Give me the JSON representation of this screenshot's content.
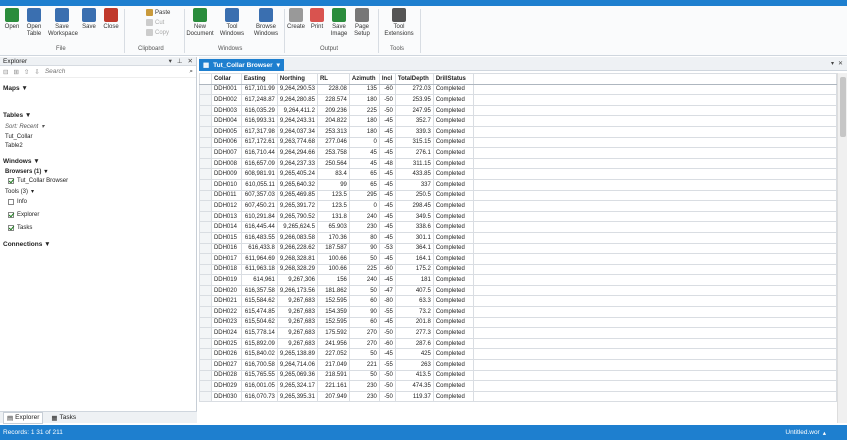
{
  "ribbon": {
    "buttons": [
      {
        "label": "Open",
        "icon": "open-icon",
        "color": "#2a8c3c"
      },
      {
        "label": "Open Table",
        "icon": "open-table-icon",
        "color": "#3a6fb0"
      },
      {
        "label": "Save Workspace",
        "icon": "save-workspace-icon",
        "color": "#3a6fb0"
      },
      {
        "label": "Save",
        "icon": "save-icon",
        "color": "#3a6fb0"
      },
      {
        "label": "Close",
        "icon": "close-icon",
        "color": "#c0392b"
      }
    ],
    "clipboard": {
      "paste": "Paste",
      "cut": "Cut",
      "copy": "Copy"
    },
    "windows": [
      {
        "label": "New Document",
        "icon": "new-document-icon",
        "color": "#2a8c3c"
      },
      {
        "label": "Tool Windows",
        "icon": "tool-windows-icon",
        "color": "#3a6fb0"
      },
      {
        "label": "Browse Windows",
        "icon": "browse-windows-icon",
        "color": "#3a6fb0"
      }
    ],
    "output": [
      {
        "label": "Create",
        "icon": "create-icon",
        "color": "#888"
      },
      {
        "label": "Print",
        "icon": "print-pdf-icon",
        "color": "#d9534f"
      },
      {
        "label": "Save Image",
        "icon": "save-image-icon",
        "color": "#2a8c3c"
      },
      {
        "label": "Page Setup",
        "icon": "page-setup-icon",
        "color": "#666"
      }
    ],
    "tools": [
      {
        "label": "Tool Extensions",
        "icon": "tool-extensions-icon",
        "color": "#555"
      }
    ],
    "groups": {
      "file": "File",
      "clipboard": "Clipboard",
      "windows": "Windows",
      "output": "Output",
      "tools": "Tools"
    }
  },
  "explorer": {
    "title": "Explorer",
    "search_placeholder": "Search",
    "sections": {
      "maps": "Maps",
      "tables": "Tables",
      "windows": "Windows",
      "connections": "Connections"
    },
    "tables": {
      "sort_label": "Sort: Recent",
      "items": [
        "Tut_Collar",
        "Table2"
      ]
    },
    "windows": {
      "browsers_label": "Browsers (1)",
      "browser_items": [
        "Tut_Collar Browser"
      ],
      "tools_label": "Tools (3)",
      "tool_items": [
        {
          "label": "Info",
          "checked": false
        },
        {
          "label": "Explorer",
          "checked": true
        },
        {
          "label": "Tasks",
          "checked": true
        }
      ]
    },
    "bottom_tabs": [
      "Explorer",
      "Tasks"
    ]
  },
  "browser": {
    "tab_title": "Tut_Collar Browser",
    "columns": [
      "Collar",
      "Easting",
      "Northing",
      "RL",
      "Azimuth",
      "Incl",
      "TotalDepth",
      "DrillStatus"
    ],
    "rows": [
      [
        "DDH001",
        "617,101.99",
        "9,264,290.53",
        "228.08",
        "135",
        "-60",
        "272.03",
        "Completed"
      ],
      [
        "DDH002",
        "617,248.87",
        "9,264,280.85",
        "228.574",
        "180",
        "-50",
        "253.95",
        "Completed"
      ],
      [
        "DDH003",
        "616,035.29",
        "9,264,411.2",
        "209.236",
        "225",
        "-50",
        "247.95",
        "Completed"
      ],
      [
        "DDH004",
        "616,993.31",
        "9,264,243.31",
        "204.822",
        "180",
        "-45",
        "352.7",
        "Completed"
      ],
      [
        "DDH005",
        "617,317.98",
        "9,264,037.34",
        "253.313",
        "180",
        "-45",
        "339.3",
        "Completed"
      ],
      [
        "DDH006",
        "617,172.61",
        "9,263,774.68",
        "277.046",
        "0",
        "-45",
        "315.15",
        "Completed"
      ],
      [
        "DDH007",
        "616,710.44",
        "9,264,294.66",
        "253.758",
        "45",
        "-45",
        "276.1",
        "Completed"
      ],
      [
        "DDH008",
        "616,657.09",
        "9,264,237.33",
        "250.564",
        "45",
        "-48",
        "311.15",
        "Completed"
      ],
      [
        "DDH009",
        "608,981.91",
        "9,265,405.24",
        "83.4",
        "65",
        "-45",
        "433.85",
        "Completed"
      ],
      [
        "DDH010",
        "610,055.11",
        "9,265,640.32",
        "99",
        "65",
        "-45",
        "337",
        "Completed"
      ],
      [
        "DDH011",
        "607,357.03",
        "9,265,469.85",
        "123.5",
        "295",
        "-45",
        "250.5",
        "Completed"
      ],
      [
        "DDH012",
        "607,450.21",
        "9,265,391.72",
        "123.5",
        "0",
        "-45",
        "298.45",
        "Completed"
      ],
      [
        "DDH013",
        "610,291.84",
        "9,265,790.52",
        "131.8",
        "240",
        "-45",
        "349.5",
        "Completed"
      ],
      [
        "DDH014",
        "616,445.44",
        "9,265,624.5",
        "65.903",
        "230",
        "-45",
        "338.6",
        "Completed"
      ],
      [
        "DDH015",
        "616,483.55",
        "9,266,083.58",
        "170.36",
        "80",
        "-45",
        "301.1",
        "Completed"
      ],
      [
        "DDH016",
        "616,433.8",
        "9,266,228.62",
        "187.587",
        "90",
        "-53",
        "364.1",
        "Completed"
      ],
      [
        "DDH017",
        "611,964.69",
        "9,268,328.81",
        "100.66",
        "50",
        "-45",
        "164.1",
        "Completed"
      ],
      [
        "DDH018",
        "611,963.18",
        "9,268,328.29",
        "100.66",
        "225",
        "-60",
        "175.2",
        "Completed"
      ],
      [
        "DDH019",
        "614,961",
        "9,267,306",
        "156",
        "240",
        "-45",
        "181",
        "Completed"
      ],
      [
        "DDH020",
        "616,357.58",
        "9,266,173.56",
        "181.862",
        "50",
        "-47",
        "407.5",
        "Completed"
      ],
      [
        "DDH021",
        "615,584.62",
        "9,267,683",
        "152.595",
        "60",
        "-80",
        "63.3",
        "Completed"
      ],
      [
        "DDH022",
        "615,474.85",
        "9,267,683",
        "154.359",
        "90",
        "-55",
        "73.2",
        "Completed"
      ],
      [
        "DDH023",
        "615,504.62",
        "9,267,683",
        "152.595",
        "60",
        "-45",
        "201.8",
        "Completed"
      ],
      [
        "DDH024",
        "615,778.14",
        "9,267,683",
        "175.592",
        "270",
        "-50",
        "277.3",
        "Completed"
      ],
      [
        "DDH025",
        "615,892.09",
        "9,267,683",
        "241.956",
        "270",
        "-60",
        "287.6",
        "Completed"
      ],
      [
        "DDH026",
        "615,840.02",
        "9,265,138.89",
        "227.052",
        "50",
        "-45",
        "425",
        "Completed"
      ],
      [
        "DDH027",
        "616,700.58",
        "9,264,714.06",
        "217.049",
        "221",
        "-55",
        "263",
        "Completed"
      ],
      [
        "DDH028",
        "615,765.55",
        "9,265,069.36",
        "218.591",
        "50",
        "-50",
        "413.5",
        "Completed"
      ],
      [
        "DDH029",
        "616,001.05",
        "9,265,324.17",
        "221.161",
        "230",
        "-50",
        "474.35",
        "Completed"
      ],
      [
        "DDH030",
        "616,070.73",
        "9,265,395.31",
        "207.949",
        "230",
        "-50",
        "119.37",
        "Completed"
      ]
    ]
  },
  "status": {
    "records": "Records: 1  31 of 211",
    "workspace": "Untitled.wor"
  },
  "colors": {
    "accent": "#1e7fcf"
  }
}
